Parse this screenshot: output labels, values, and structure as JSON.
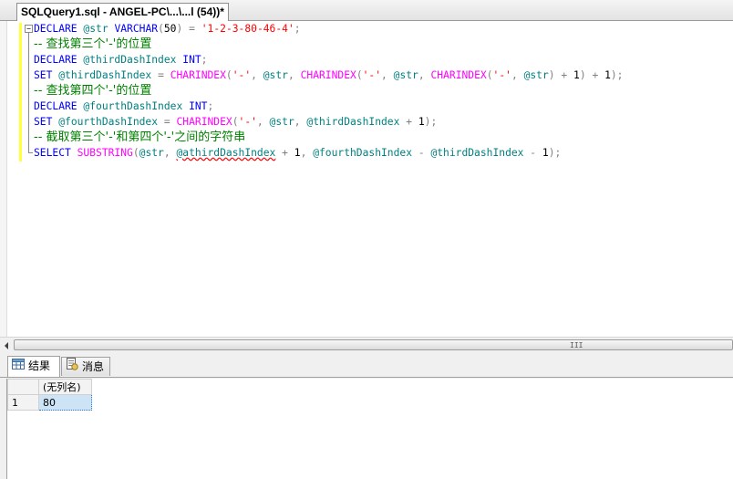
{
  "tab": {
    "title": "SQLQuery1.sql - ANGEL-PC\\...\\...l (54))*"
  },
  "code_lines": [
    [
      {
        "t": "DECLARE",
        "c": "kw"
      },
      {
        "t": " "
      },
      {
        "t": "@str",
        "c": "var"
      },
      {
        "t": " "
      },
      {
        "t": "VARCHAR",
        "c": "kw"
      },
      {
        "t": "(",
        "c": "op"
      },
      {
        "t": "50"
      },
      {
        "t": ")",
        "c": "op"
      },
      {
        "t": " "
      },
      {
        "t": "=",
        "c": "op"
      },
      {
        "t": " "
      },
      {
        "t": "'1-2-3-80-46-4'",
        "c": "str"
      },
      {
        "t": ";",
        "c": "op"
      }
    ],
    [
      {
        "t": "-- 查找第三个'-'的位置",
        "c": "cmt"
      }
    ],
    [
      {
        "t": "DECLARE",
        "c": "kw"
      },
      {
        "t": " "
      },
      {
        "t": "@thirdDashIndex",
        "c": "var"
      },
      {
        "t": " "
      },
      {
        "t": "INT",
        "c": "kw"
      },
      {
        "t": ";",
        "c": "op"
      }
    ],
    [
      {
        "t": "SET",
        "c": "kw"
      },
      {
        "t": " "
      },
      {
        "t": "@thirdDashIndex",
        "c": "var"
      },
      {
        "t": " "
      },
      {
        "t": "=",
        "c": "op"
      },
      {
        "t": " "
      },
      {
        "t": "CHARINDEX",
        "c": "fn"
      },
      {
        "t": "(",
        "c": "op"
      },
      {
        "t": "'-'",
        "c": "str"
      },
      {
        "t": ",",
        "c": "op"
      },
      {
        "t": " "
      },
      {
        "t": "@str",
        "c": "var"
      },
      {
        "t": ",",
        "c": "op"
      },
      {
        "t": " "
      },
      {
        "t": "CHARINDEX",
        "c": "fn"
      },
      {
        "t": "(",
        "c": "op"
      },
      {
        "t": "'-'",
        "c": "str"
      },
      {
        "t": ",",
        "c": "op"
      },
      {
        "t": " "
      },
      {
        "t": "@str",
        "c": "var"
      },
      {
        "t": ",",
        "c": "op"
      },
      {
        "t": " "
      },
      {
        "t": "CHARINDEX",
        "c": "fn"
      },
      {
        "t": "(",
        "c": "op"
      },
      {
        "t": "'-'",
        "c": "str"
      },
      {
        "t": ",",
        "c": "op"
      },
      {
        "t": " "
      },
      {
        "t": "@str",
        "c": "var"
      },
      {
        "t": ")",
        "c": "op"
      },
      {
        "t": " "
      },
      {
        "t": "+",
        "c": "op"
      },
      {
        "t": " 1"
      },
      {
        "t": ")",
        "c": "op"
      },
      {
        "t": " "
      },
      {
        "t": "+",
        "c": "op"
      },
      {
        "t": " 1"
      },
      {
        "t": ");",
        "c": "op"
      }
    ],
    [
      {
        "t": "-- 查找第四个'-'的位置",
        "c": "cmt"
      }
    ],
    [
      {
        "t": "DECLARE",
        "c": "kw"
      },
      {
        "t": " "
      },
      {
        "t": "@fourthDashIndex",
        "c": "var"
      },
      {
        "t": " "
      },
      {
        "t": "INT",
        "c": "kw"
      },
      {
        "t": ";",
        "c": "op"
      }
    ],
    [
      {
        "t": "SET",
        "c": "kw"
      },
      {
        "t": " "
      },
      {
        "t": "@fourthDashIndex",
        "c": "var"
      },
      {
        "t": " "
      },
      {
        "t": "=",
        "c": "op"
      },
      {
        "t": " "
      },
      {
        "t": "CHARINDEX",
        "c": "fn"
      },
      {
        "t": "(",
        "c": "op"
      },
      {
        "t": "'-'",
        "c": "str"
      },
      {
        "t": ",",
        "c": "op"
      },
      {
        "t": " "
      },
      {
        "t": "@str",
        "c": "var"
      },
      {
        "t": ",",
        "c": "op"
      },
      {
        "t": " "
      },
      {
        "t": "@thirdDashIndex",
        "c": "var"
      },
      {
        "t": " "
      },
      {
        "t": "+",
        "c": "op"
      },
      {
        "t": " 1"
      },
      {
        "t": ");",
        "c": "op"
      }
    ],
    [
      {
        "t": "-- 截取第三个'-'和第四个'-'之间的字符串",
        "c": "cmt"
      }
    ],
    [
      {
        "t": "SELECT",
        "c": "kw"
      },
      {
        "t": " "
      },
      {
        "t": "SUBSTRING",
        "c": "fn"
      },
      {
        "t": "(",
        "c": "op"
      },
      {
        "t": "@str",
        "c": "var"
      },
      {
        "t": ",",
        "c": "op"
      },
      {
        "t": " "
      },
      {
        "t": "@athirdDashIndex",
        "c": "var err"
      },
      {
        "t": " "
      },
      {
        "t": "+",
        "c": "op"
      },
      {
        "t": " 1"
      },
      {
        "t": ",",
        "c": "op"
      },
      {
        "t": " "
      },
      {
        "t": "@fourthDashIndex",
        "c": "var"
      },
      {
        "t": " "
      },
      {
        "t": "-",
        "c": "op"
      },
      {
        "t": " "
      },
      {
        "t": "@thirdDashIndex",
        "c": "var"
      },
      {
        "t": " "
      },
      {
        "t": "-",
        "c": "op"
      },
      {
        "t": " 1"
      },
      {
        "t": ");",
        "c": "op"
      }
    ]
  ],
  "collapse_glyph": "−",
  "scroll_grip": "III",
  "results_tabs": [
    {
      "label": "结果",
      "icon": "grid-icon",
      "active": true
    },
    {
      "label": "消息",
      "icon": "messages-icon",
      "active": false
    }
  ],
  "grid": {
    "columns": [
      "(无列名)"
    ],
    "rows": [
      {
        "row_number": "1",
        "values": [
          "80"
        ]
      }
    ]
  },
  "colors": {
    "keyword": "#0000ff",
    "function": "#ff00ff",
    "string": "#ff0000",
    "variable": "#008080",
    "comment": "#008000",
    "change_bar": "#ffff3a",
    "selected_cell": "#cde4f7"
  }
}
